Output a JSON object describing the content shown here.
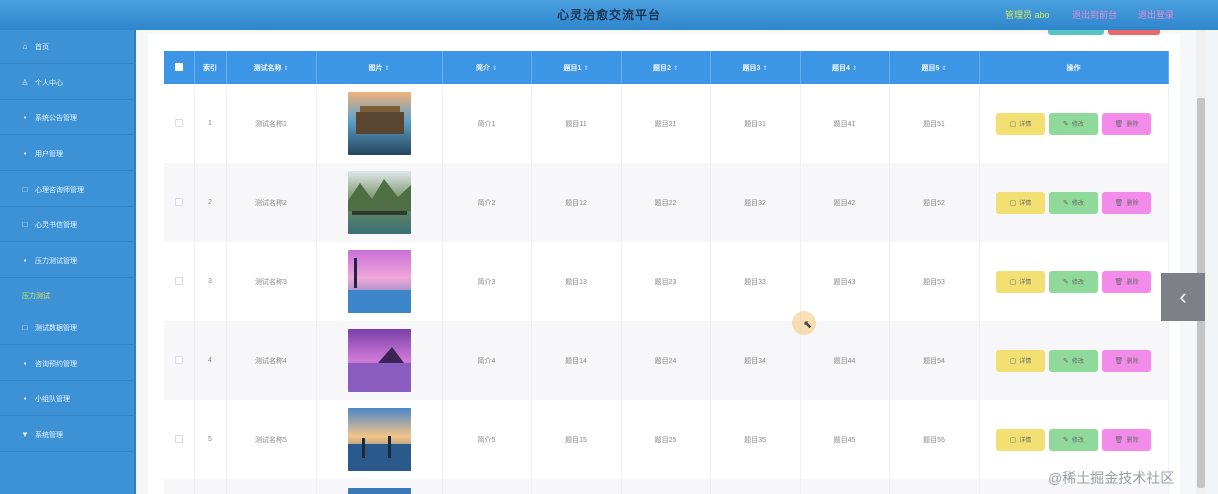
{
  "header": {
    "title": "心灵治愈交流平台",
    "admin_label": "管理员 abo",
    "link_1": "退出到前台",
    "link_2": "退出登录"
  },
  "sidebar": {
    "items": [
      {
        "label": "首页",
        "icon": "home-icon"
      },
      {
        "label": "个人中心",
        "icon": "user-icon"
      },
      {
        "label": "系统公告管理",
        "icon": "bell-icon"
      },
      {
        "label": "用户管理",
        "icon": "users-icon"
      },
      {
        "label": "心理咨询师管理",
        "icon": "doctor-icon"
      },
      {
        "label": "心灵书信管理",
        "icon": "mail-icon"
      },
      {
        "label": "压力测试管理",
        "icon": "chart-icon"
      },
      {
        "label": "测试数据管理",
        "icon": "data-icon"
      },
      {
        "label": "咨询预约管理",
        "icon": "calendar-icon"
      },
      {
        "label": "小组队管理",
        "icon": "group-icon"
      },
      {
        "label": "系统管理",
        "icon": "settings-icon"
      }
    ],
    "active_sub": "压力测试"
  },
  "table": {
    "columns": [
      "索引",
      "测试名称",
      "图片",
      "简介",
      "题目1",
      "题目2",
      "题目3",
      "题目4",
      "题目5",
      "操作"
    ],
    "rows": [
      {
        "index": "1",
        "name": "测试名称1",
        "intro": "简介1",
        "q1": "题目11",
        "q2": "题目21",
        "q3": "题目31",
        "q4": "题目41",
        "q5": "题目51"
      },
      {
        "index": "2",
        "name": "测试名称2",
        "intro": "简介2",
        "q1": "题目12",
        "q2": "题目22",
        "q3": "题目32",
        "q4": "题目42",
        "q5": "题目52"
      },
      {
        "index": "3",
        "name": "测试名称3",
        "intro": "简介3",
        "q1": "题目13",
        "q2": "题目23",
        "q3": "题目33",
        "q4": "题目43",
        "q5": "题目53"
      },
      {
        "index": "4",
        "name": "测试名称4",
        "intro": "简介4",
        "q1": "题目14",
        "q2": "题目24",
        "q3": "题目34",
        "q4": "题目44",
        "q5": "题目54"
      },
      {
        "index": "5",
        "name": "测试名称5",
        "intro": "简介5",
        "q1": "题目15",
        "q2": "题目25",
        "q3": "题目35",
        "q4": "题目45",
        "q5": "题目55"
      }
    ],
    "actions": {
      "detail": "详情",
      "edit": "修改",
      "delete": "删除"
    }
  },
  "icons": {
    "side_toggle": "chevron-left-icon",
    "cursor": "mouse-pointer-icon"
  },
  "watermark": "@稀土掘金技术社区",
  "colors": {
    "header_blue": "#3d95e6",
    "sidebar_blue": "#3d92d5",
    "detail_button": "#f2e073",
    "edit_button": "#8fd99a",
    "delete_button": "#f28bea"
  }
}
